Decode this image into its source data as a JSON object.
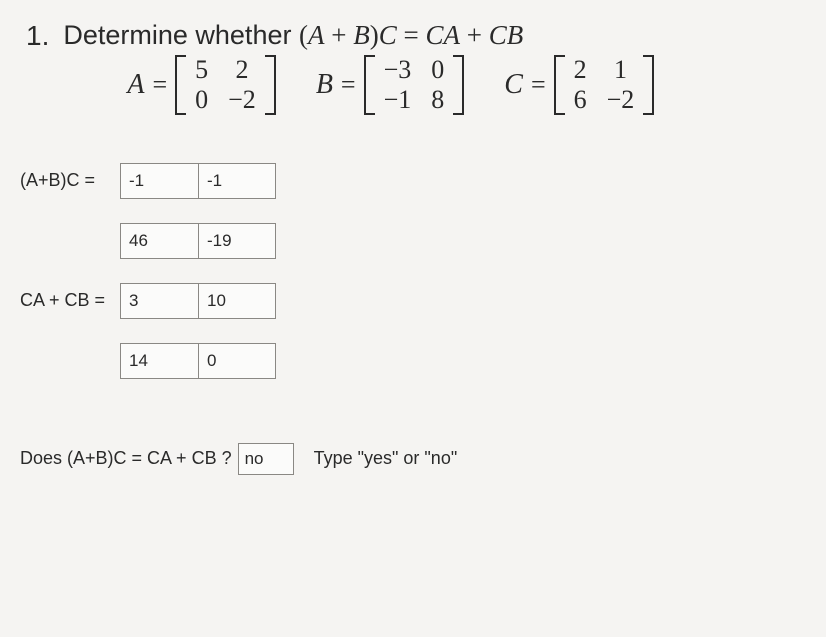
{
  "question": {
    "number": "1.",
    "prompt_prefix": "Determine whether ",
    "equation_lhs": "(A + B)C",
    "equation_rhs": "CA + CB"
  },
  "matrices": {
    "A": {
      "name": "A",
      "rows": [
        [
          "5",
          "2"
        ],
        [
          "0",
          "−2"
        ]
      ]
    },
    "B": {
      "name": "B",
      "rows": [
        [
          "−3",
          "0"
        ],
        [
          "−1",
          "8"
        ]
      ]
    },
    "C": {
      "name": "C",
      "rows": [
        [
          "2",
          "1"
        ],
        [
          "6",
          "−2"
        ]
      ]
    }
  },
  "answers": {
    "abc_label": "(A+B)C =",
    "abc": {
      "r1": [
        "-1",
        "-1"
      ],
      "r2": [
        "46",
        "-19"
      ]
    },
    "cacb_label": "CA + CB =",
    "cacb": {
      "r1": [
        "3",
        "10"
      ],
      "r2": [
        "14",
        "0"
      ]
    }
  },
  "final": {
    "prompt": "Does (A+B)C = CA + CB ?",
    "value": "no",
    "hint": "Type \"yes\" or \"no\""
  }
}
